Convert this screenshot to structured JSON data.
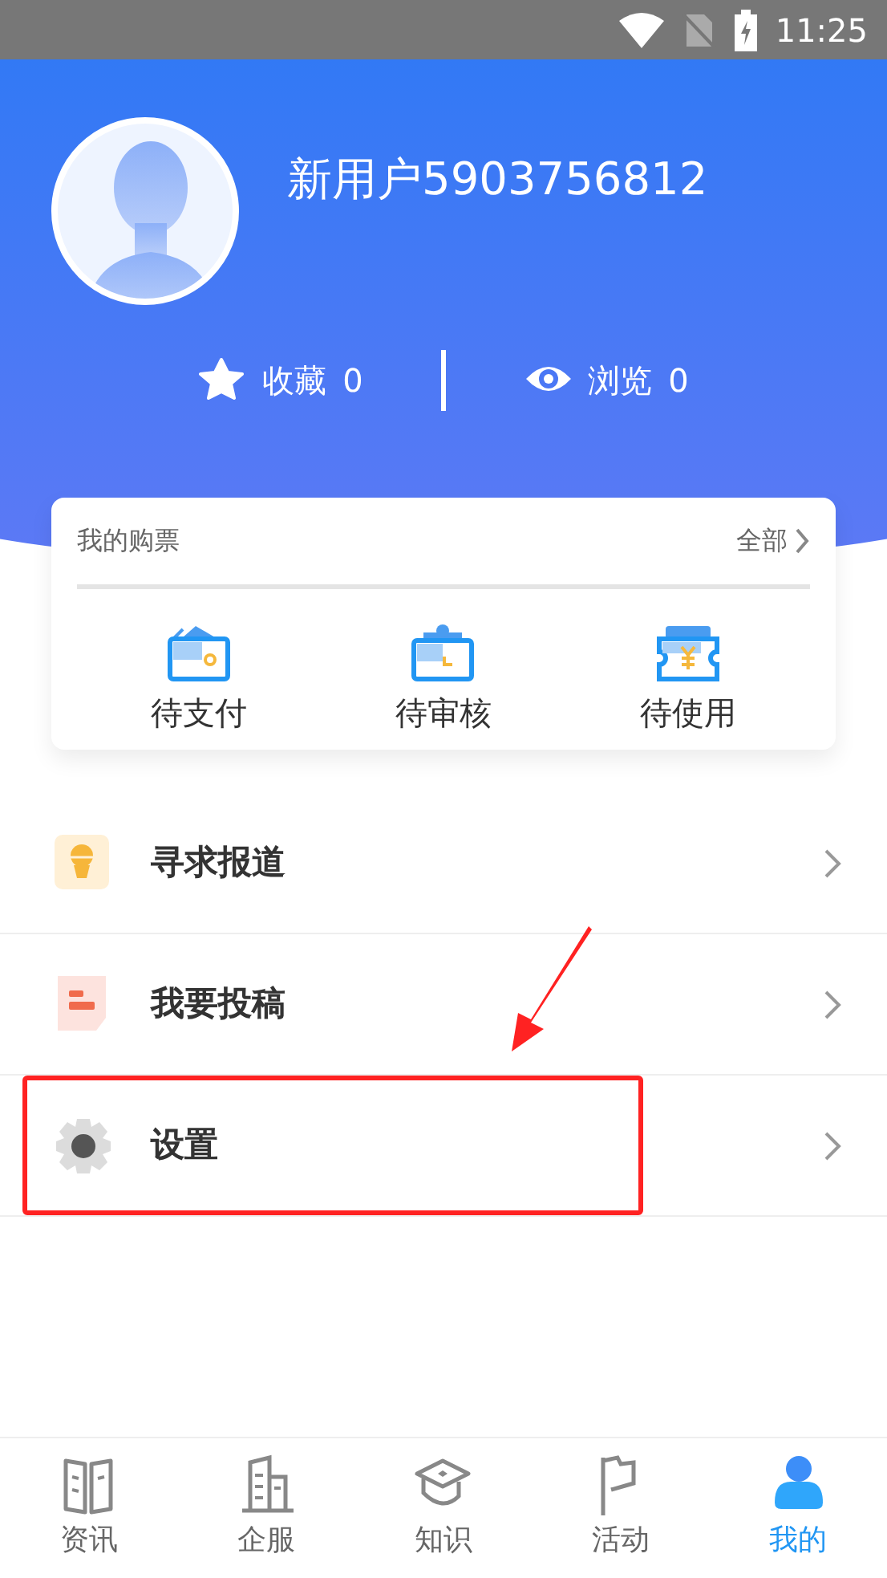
{
  "status_bar": {
    "time": "11:25"
  },
  "profile": {
    "username": "新用户5903756812",
    "stats": [
      {
        "kind": "star",
        "label": "收藏",
        "count": "0"
      },
      {
        "kind": "eye",
        "label": "浏览",
        "count": "0"
      }
    ]
  },
  "tickets": {
    "title": "我的购票",
    "all_link": "全部",
    "items": [
      {
        "kind": "wallet",
        "label": "待支付"
      },
      {
        "kind": "clipboard",
        "label": "待审核"
      },
      {
        "kind": "ticket",
        "label": "待使用"
      }
    ]
  },
  "menu": [
    {
      "kind": "mic",
      "label": "寻求报道",
      "highlighted": false
    },
    {
      "kind": "doc",
      "label": "我要投稿",
      "highlighted": false
    },
    {
      "kind": "gear",
      "label": "设置",
      "highlighted": true
    }
  ],
  "tabs": [
    {
      "kind": "book",
      "label": "资讯",
      "selected": false
    },
    {
      "kind": "building",
      "label": "企服",
      "selected": false
    },
    {
      "kind": "cap",
      "label": "知识",
      "selected": false
    },
    {
      "kind": "flag",
      "label": "活动",
      "selected": false
    },
    {
      "kind": "person",
      "label": "我的",
      "selected": true
    }
  ]
}
